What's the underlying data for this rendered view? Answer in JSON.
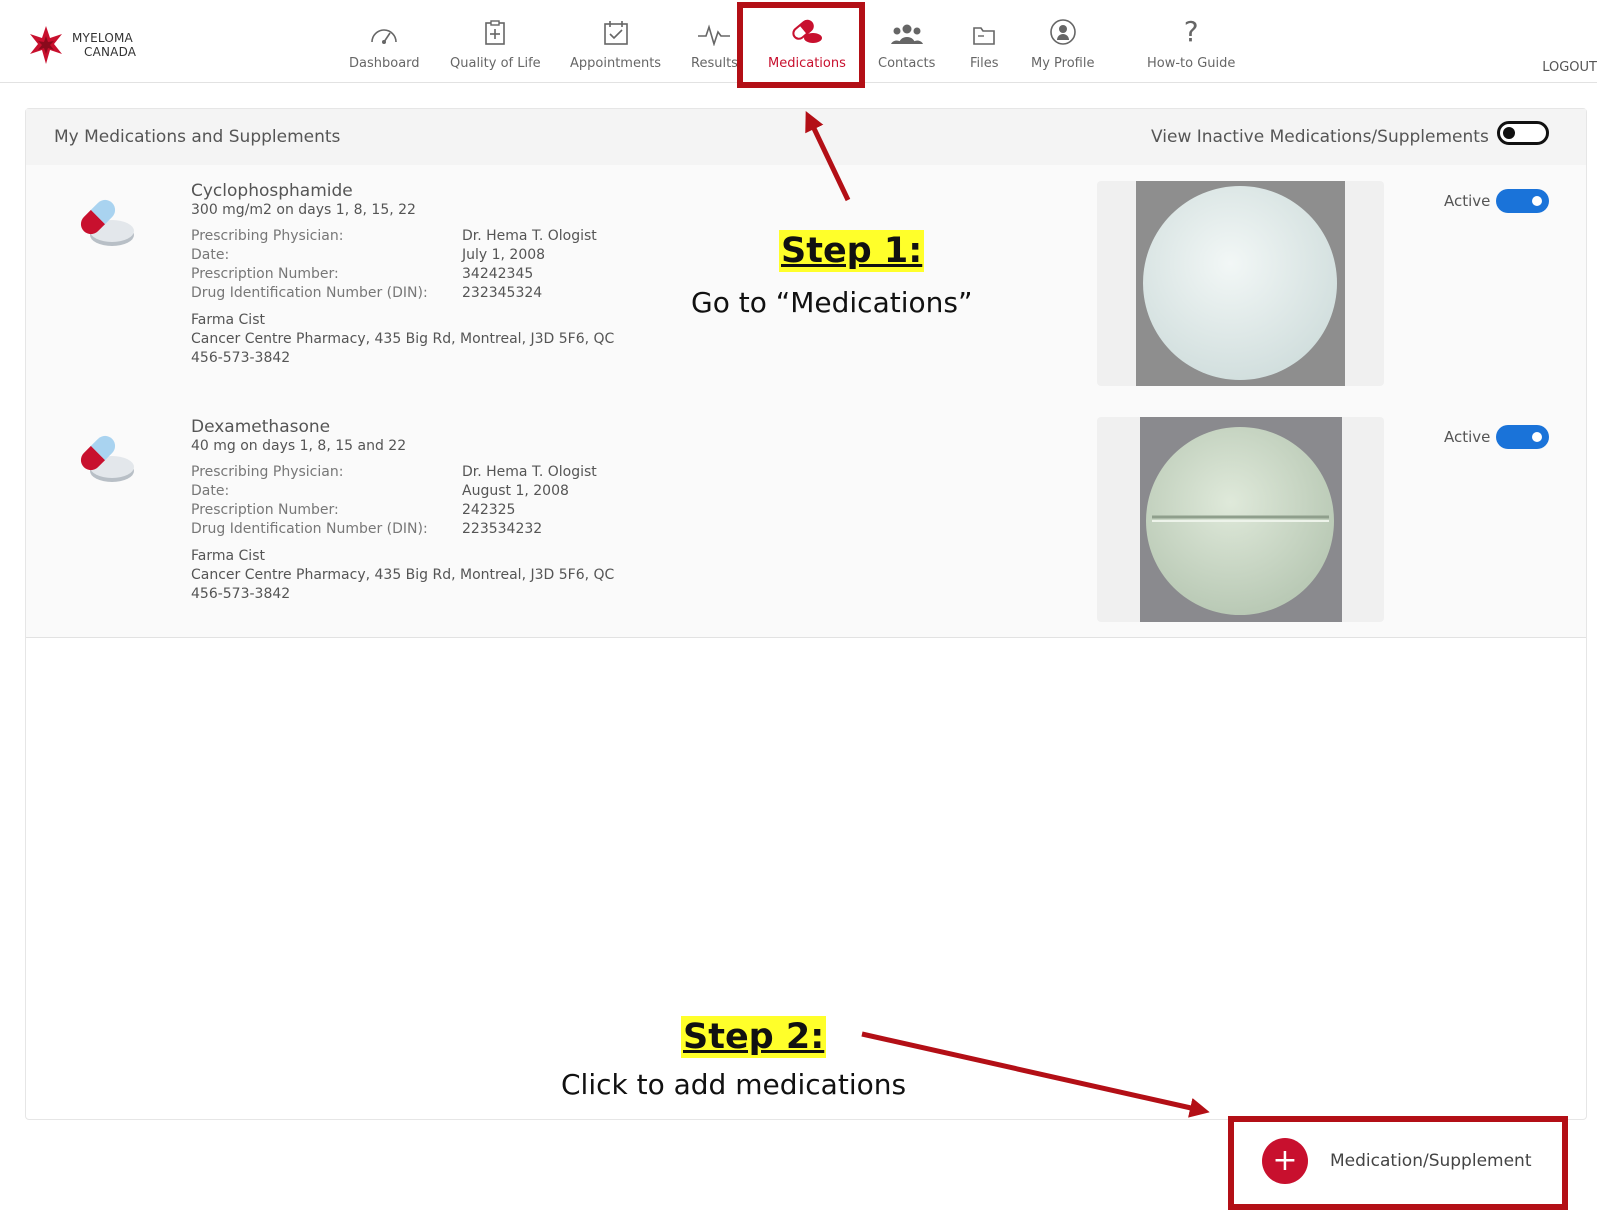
{
  "brand": {
    "line1": "MYELOMA",
    "line2": "CANADA",
    "logo_icon": "maple-leaf-star-icon",
    "accent": "#c8102e"
  },
  "nav": {
    "items": [
      {
        "label": "Dashboard",
        "icon": "gauge-icon"
      },
      {
        "label": "Quality of Life",
        "icon": "clipboard-plus-icon"
      },
      {
        "label": "Appointments",
        "icon": "calendar-check-icon"
      },
      {
        "label": "Results",
        "icon": "pulse-icon"
      },
      {
        "label": "Medications",
        "icon": "pills-icon",
        "active": true
      },
      {
        "label": "Contacts",
        "icon": "people-icon"
      },
      {
        "label": "Files",
        "icon": "folder-icon"
      },
      {
        "label": "My Profile",
        "icon": "profile-icon"
      },
      {
        "label": "How-to Guide",
        "icon": "question-icon"
      }
    ],
    "logout": "LOGOUT"
  },
  "panel": {
    "title": "My Medications and Supplements",
    "inactive_label": "View Inactive Medications/Supplements",
    "inactive_toggle_on": false
  },
  "field_labels": {
    "physician": "Prescribing Physician:",
    "date": "Date:",
    "rx": "Prescription Number:",
    "din": "Drug Identification Number (DIN):"
  },
  "medications": [
    {
      "name": "Cyclophosphamide",
      "dose": "300 mg/m2 on days 1, 8, 15, 22",
      "physician": "Dr. Hema T. Ologist",
      "date": "July 1, 2008",
      "rx": "34242345",
      "din": "232345324",
      "pharmacist": "Farma Cist",
      "pharmacy": "Cancer Centre Pharmacy, 435 Big Rd, Montreal, J3D 5F6, QC",
      "phone": "456-573-3842",
      "status": "Active",
      "status_on": true
    },
    {
      "name": "Dexamethasone",
      "dose": "40 mg on days 1, 8, 15 and 22",
      "physician": "Dr. Hema T. Ologist",
      "date": "August 1, 2008",
      "rx": "242325",
      "din": "223534232",
      "pharmacist": "Farma Cist",
      "pharmacy": "Cancer Centre Pharmacy, 435 Big Rd, Montreal, J3D 5F6, QC",
      "phone": "456-573-3842",
      "status": "Active",
      "status_on": true
    }
  ],
  "add_button": {
    "icon": "plus-icon",
    "label": "Medication/Supplement"
  },
  "annotations": {
    "step1_title": "Step 1:",
    "step1_desc": "Go to “Medications”",
    "step2_title": "Step 2:",
    "step2_desc": "Click to add medications",
    "color": "#b30f16",
    "highlight": "#ffff2a"
  }
}
